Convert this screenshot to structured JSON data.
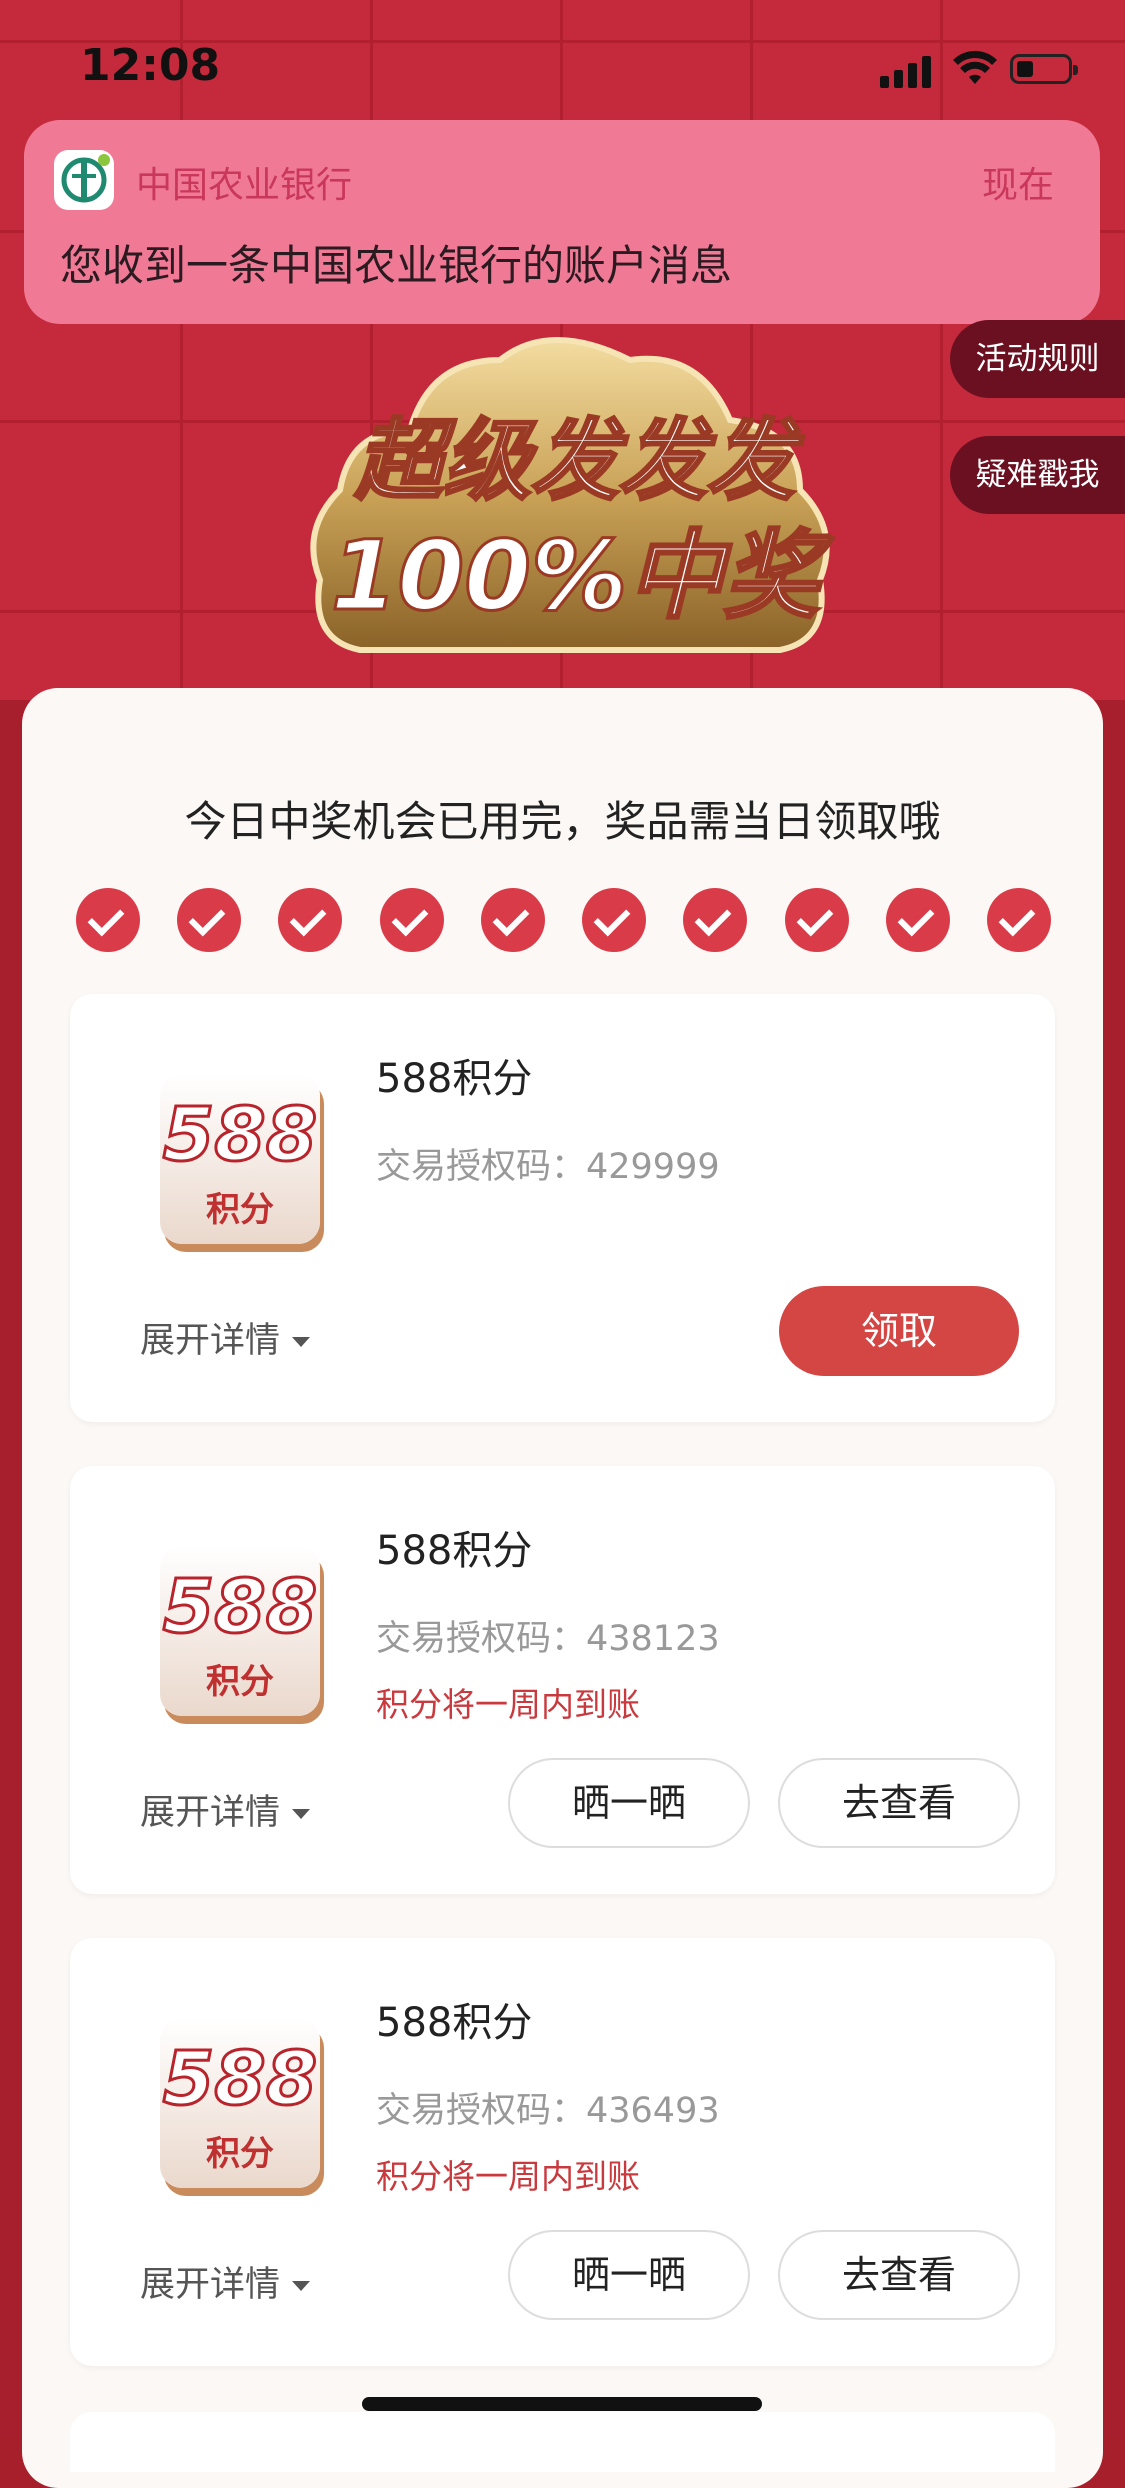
{
  "status_bar": {
    "time": "12:08"
  },
  "notification": {
    "app_name": "中国农业银行",
    "time": "现在",
    "message": "您收到一条中国农业银行的账户消息"
  },
  "side_buttons": {
    "rules": "活动规则",
    "help": "疑难戳我"
  },
  "hero": {
    "line1": "超级发发发",
    "line2": "100%中奖"
  },
  "headline": "今日中奖机会已用完，奖品需当日领取哦",
  "chances": {
    "used": 10,
    "total": 10
  },
  "cards": [
    {
      "badge_number": "588",
      "badge_unit": "积分",
      "title": "588积分",
      "code": "交易授权码：429999",
      "note": "",
      "expand": "展开详情",
      "primary_button": "领取"
    },
    {
      "badge_number": "588",
      "badge_unit": "积分",
      "title": "588积分",
      "code": "交易授权码：438123",
      "note": "积分将一周内到账",
      "expand": "展开详情",
      "share_button": "晒一晒",
      "view_button": "去查看"
    },
    {
      "badge_number": "588",
      "badge_unit": "积分",
      "title": "588积分",
      "code": "交易授权码：436493",
      "note": "积分将一周内到账",
      "expand": "展开详情",
      "share_button": "晒一晒",
      "view_button": "去查看"
    }
  ],
  "colors": {
    "primary_red": "#d44644",
    "check_red": "#d93c48",
    "note_red": "#c93a3e",
    "banner_pink": "#f07a96"
  }
}
